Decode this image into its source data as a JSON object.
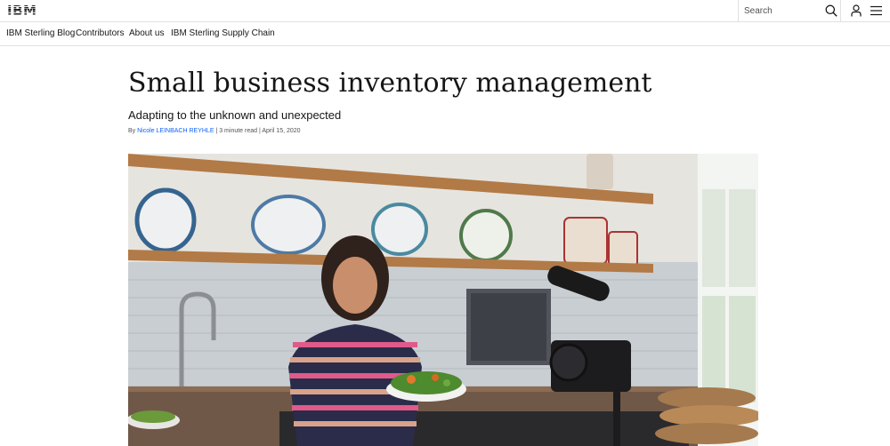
{
  "masthead": {
    "logo": "IBM",
    "search": {
      "placeholder": "Search"
    },
    "icons": [
      "search-icon",
      "user-icon",
      "menu-icon"
    ]
  },
  "subnav": {
    "items": [
      {
        "label": "IBM Sterling Blog"
      },
      {
        "label": "Contributors"
      },
      {
        "label": "About us"
      },
      {
        "label": "IBM Sterling Supply Chain"
      }
    ]
  },
  "article": {
    "title": "Small business inventory management",
    "subtitle": "Adapting to the unknown and unexpected",
    "byline": {
      "prefix": "By ",
      "author": "Nicole LEINBACH REYHLE",
      "sep1": " | ",
      "read_time": "3 minute read",
      "sep2": " | ",
      "date": "April 15, 2020"
    }
  },
  "colors": {
    "link": "#0f62fe",
    "text": "#161616",
    "border": "#e0e0e0"
  }
}
